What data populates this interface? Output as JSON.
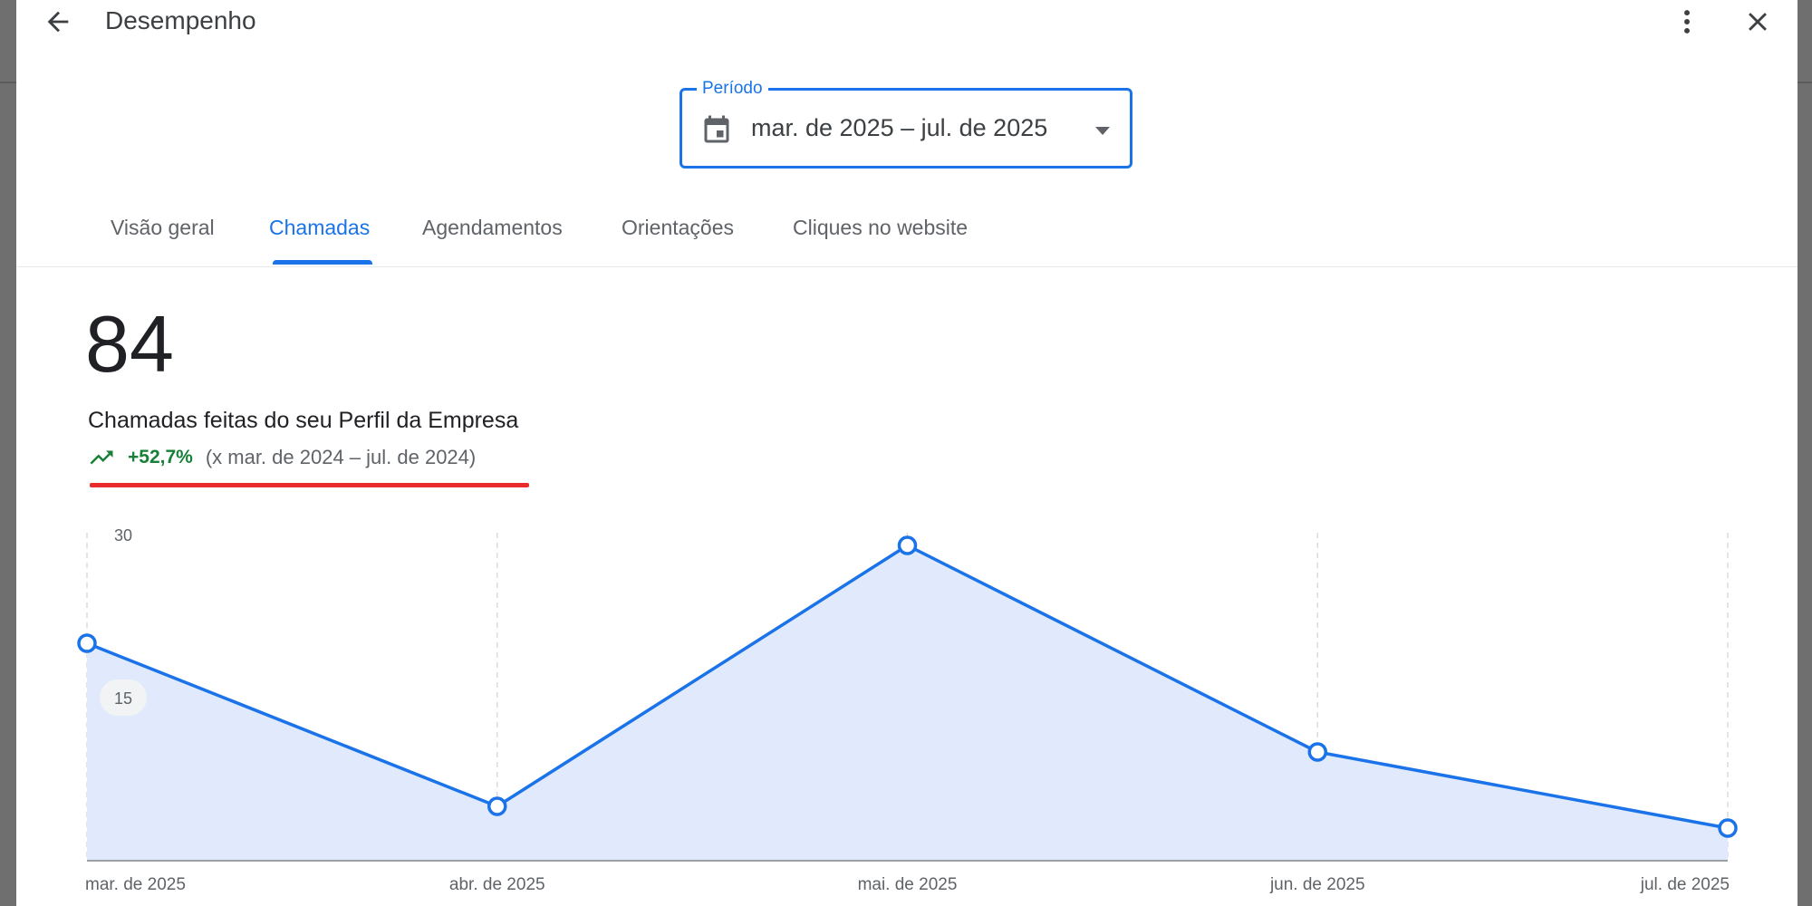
{
  "header": {
    "title": "Desempenho",
    "back_icon": "arrow-back-icon",
    "more_icon": "more-vert-icon",
    "close_icon": "close-icon"
  },
  "period": {
    "label": "Período",
    "value": "mar. de 2025 – jul. de 2025",
    "calendar_icon": "calendar-icon",
    "dropdown_icon": "arrow-drop-down-icon"
  },
  "tabs": [
    {
      "label": "Visão geral",
      "active": false
    },
    {
      "label": "Chamadas",
      "active": true
    },
    {
      "label": "Agendamentos",
      "active": false
    },
    {
      "label": "Orientações",
      "active": false
    },
    {
      "label": "Cliques no website",
      "active": false
    }
  ],
  "metric": {
    "value": "84",
    "label": "Chamadas feitas do seu Perfil da Empresa",
    "trend_icon": "trending-up-icon",
    "trend_pct": "+52,7%",
    "comparison": "(x mar. de 2024 – jul. de 2024)"
  },
  "colors": {
    "accent": "#1a73e8",
    "positive": "#188038",
    "annotation": "#ea2b2b",
    "area_fill": "#e1eafd"
  },
  "chart_data": {
    "type": "area",
    "categories": [
      "mar. de 2025",
      "abr. de 2025",
      "mai. de 2025",
      "jun. de 2025",
      "jul. de 2025"
    ],
    "values": [
      20,
      5,
      29,
      10,
      3
    ],
    "yticks": [
      "30",
      "15"
    ],
    "ylim": [
      0,
      30
    ],
    "grid": "vertical dashed",
    "markers": "hollow circles"
  }
}
